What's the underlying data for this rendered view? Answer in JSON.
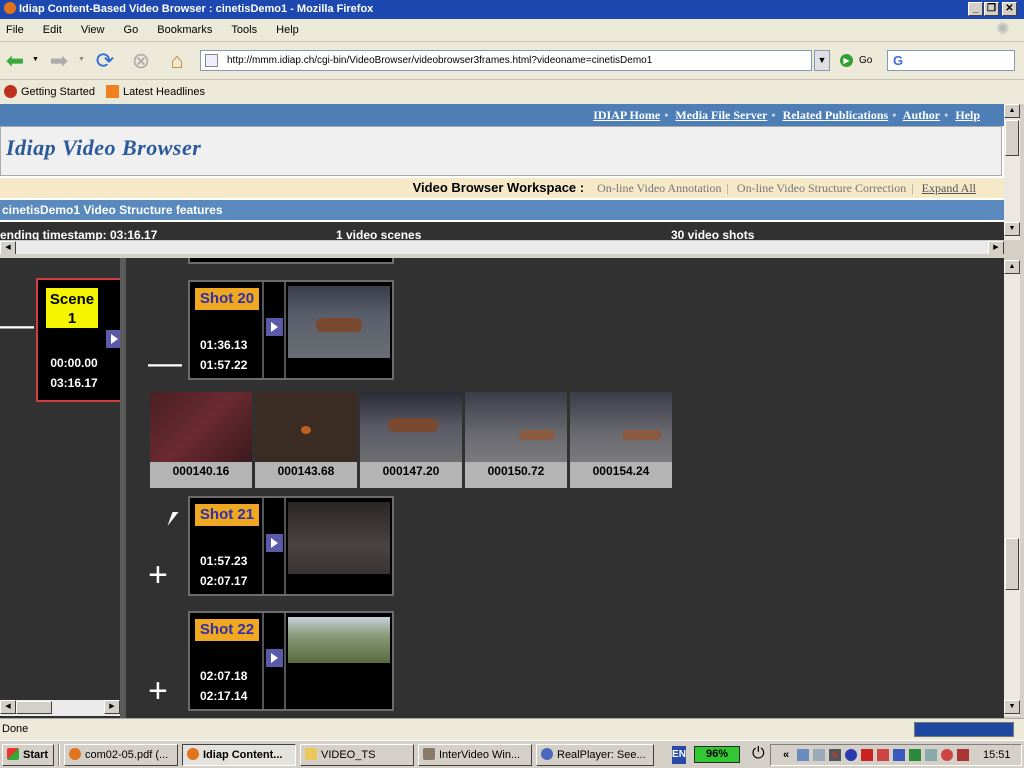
{
  "window": {
    "title": "Idiap Content-Based Video Browser : cinetisDemo1 - Mozilla Firefox"
  },
  "menu": [
    "File",
    "Edit",
    "View",
    "Go",
    "Bookmarks",
    "Tools",
    "Help"
  ],
  "nav": {
    "url": "http://mmm.idiap.ch/cgi-bin/VideoBrowser/videobrowser3frames.html?videoname=cinetisDemo1",
    "go_label": "Go",
    "search_logo": "G"
  },
  "bookmarks": [
    "Getting Started",
    "Latest Headlines"
  ],
  "page": {
    "links": [
      "IDIAP Home",
      "Media File Server",
      "Related Publications",
      "Author",
      "Help"
    ],
    "title": "Idiap Video Browser",
    "workspace_label": "Video Browser Workspace :",
    "workspace_links": [
      "On-line Video Annotation",
      "On-line Video Structure Correction"
    ],
    "expand_all": "Expand All",
    "features_title": "cinetisDemo1 Video Structure features",
    "stats": {
      "ending": "ending timestamp: 03:16.17",
      "scenes": "1 video scenes",
      "shots": "30 video shots"
    }
  },
  "scene": {
    "label": "Scene 1",
    "start": "00:00.00",
    "end": "03:16.17"
  },
  "shots": [
    {
      "label": "Shot 20",
      "start": "01:36.13",
      "end": "01:57.22",
      "control": "—"
    },
    {
      "label": "Shot 21",
      "start": "01:57.23",
      "end": "02:07.17",
      "control": "+"
    },
    {
      "label": "Shot 22",
      "start": "02:07.18",
      "end": "02:17.14",
      "control": "+"
    }
  ],
  "keyframes": [
    "000140.16",
    "000143.68",
    "000147.20",
    "000150.72",
    "000154.24"
  ],
  "scene_control": "—",
  "status": {
    "text": "Done"
  },
  "taskbar": {
    "start": "Start",
    "items": [
      "com02-05.pdf (...",
      "Idiap Content...",
      "VIDEO_TS",
      "InterVideo Win...",
      "RealPlayer: See..."
    ],
    "lang": "EN",
    "battery": "96%",
    "clock": "15:51"
  },
  "colors": {
    "title_bar": "#1c48b0",
    "link_bar": "#4d7eb5",
    "shot_label": "#f0a820",
    "scene_label": "#f5f500",
    "frame_bg": "#313131"
  }
}
